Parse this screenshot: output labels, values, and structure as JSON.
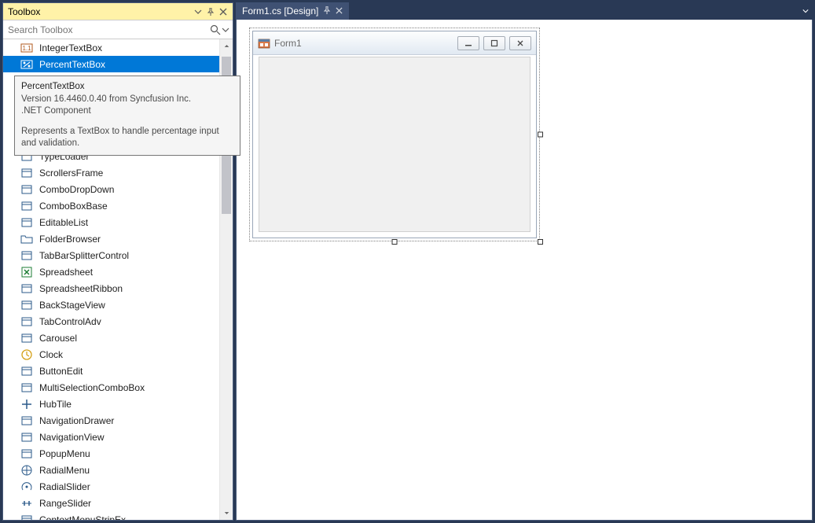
{
  "toolbox": {
    "title": "Toolbox",
    "search_placeholder": "Search Toolbox",
    "items": [
      {
        "label": "IntegerTextBox",
        "icon": "integer-icon",
        "selected": false
      },
      {
        "label": "PercentTextBox",
        "icon": "percent-icon",
        "selected": true
      },
      {
        "label": "TypeLoader",
        "icon": "typeloader-icon",
        "selected": false,
        "obscured": true
      },
      {
        "label": "ScrollersFrame",
        "icon": "scrollers-icon",
        "selected": false
      },
      {
        "label": "ComboDropDown",
        "icon": "combodrop-icon",
        "selected": false
      },
      {
        "label": "ComboBoxBase",
        "icon": "combobox-icon",
        "selected": false
      },
      {
        "label": "EditableList",
        "icon": "editlist-icon",
        "selected": false
      },
      {
        "label": "FolderBrowser",
        "icon": "folder-icon",
        "selected": false
      },
      {
        "label": "TabBarSplitterControl",
        "icon": "tabbar-icon",
        "selected": false
      },
      {
        "label": "Spreadsheet",
        "icon": "spreadsheet-icon",
        "selected": false
      },
      {
        "label": "SpreadsheetRibbon",
        "icon": "ribbon-icon",
        "selected": false
      },
      {
        "label": "BackStageView",
        "icon": "backstage-icon",
        "selected": false
      },
      {
        "label": "TabControlAdv",
        "icon": "tabcontrol-icon",
        "selected": false
      },
      {
        "label": "Carousel",
        "icon": "carousel-icon",
        "selected": false
      },
      {
        "label": "Clock",
        "icon": "clock-icon",
        "selected": false
      },
      {
        "label": "ButtonEdit",
        "icon": "buttonedit-icon",
        "selected": false
      },
      {
        "label": "MultiSelectionComboBox",
        "icon": "multicombo-icon",
        "selected": false
      },
      {
        "label": "HubTile",
        "icon": "hubtile-icon",
        "selected": false
      },
      {
        "label": "NavigationDrawer",
        "icon": "navdrawer-icon",
        "selected": false
      },
      {
        "label": "NavigationView",
        "icon": "navview-icon",
        "selected": false
      },
      {
        "label": "PopupMenu",
        "icon": "popupmenu-icon",
        "selected": false
      },
      {
        "label": "RadialMenu",
        "icon": "radialmenu-icon",
        "selected": false
      },
      {
        "label": "RadialSlider",
        "icon": "radialslider-icon",
        "selected": false
      },
      {
        "label": "RangeSlider",
        "icon": "rangeslider-icon",
        "selected": false
      },
      {
        "label": "ContextMenuStripEx",
        "icon": "contextmenu-icon",
        "selected": false
      }
    ]
  },
  "tooltip": {
    "title": "PercentTextBox",
    "version_line": "Version 16.4460.0.40 from Syncfusion Inc.",
    "component_line": ".NET Component",
    "description": "Represents a TextBox to handle percentage input and validation."
  },
  "editor": {
    "tab_label": "Form1.cs [Design]",
    "form_title": "Form1"
  }
}
